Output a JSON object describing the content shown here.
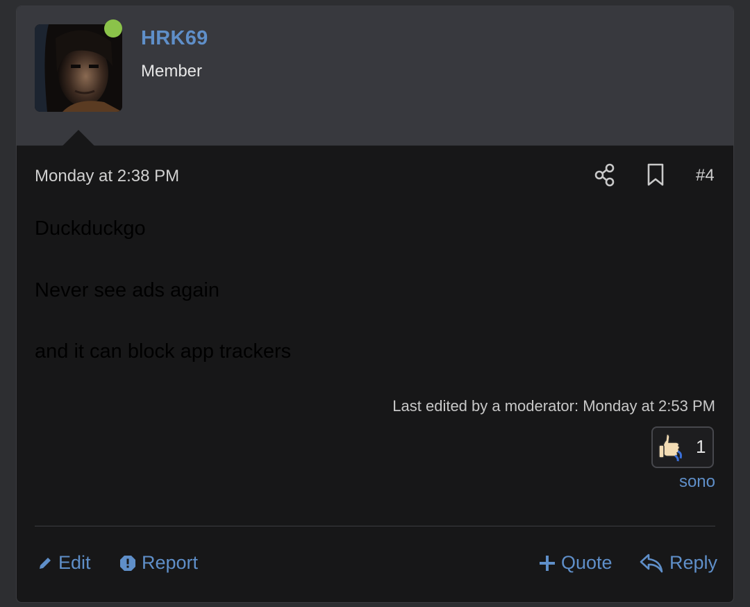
{
  "user": {
    "name": "HRK69",
    "title": "Member",
    "online": true,
    "online_color": "#8bc34a",
    "name_color": "#5f8fc9"
  },
  "post": {
    "date": "Monday at 2:38 PM",
    "number": "#4",
    "share_icon": "share-icon",
    "bookmark_icon": "bookmark-icon",
    "body": [
      "Duckduckgo",
      "Never see ads again",
      "and it can block app trackers"
    ],
    "last_edited": "Last edited by a moderator: Monday at 2:53 PM",
    "reaction": {
      "icon": "thumbs-up-icon",
      "count": "1",
      "user": "sono"
    }
  },
  "footer": {
    "edit_label": "Edit",
    "report_label": "Report",
    "quote_label": "Quote",
    "reply_label": "Reply"
  }
}
